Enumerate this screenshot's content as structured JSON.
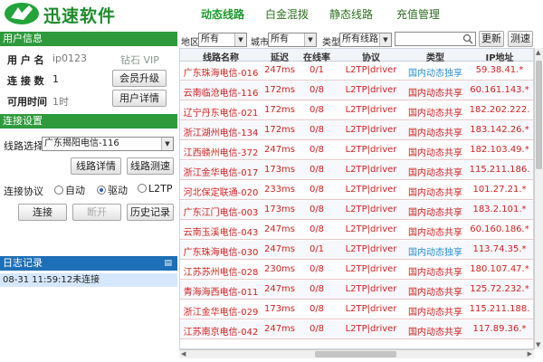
{
  "app": {
    "brand": "迅速软件",
    "nav_tabs": [
      "动态线路",
      "白金混拨",
      "静态线路",
      "充值管理"
    ]
  },
  "user_info": {
    "header": "用户信息",
    "username_label": "用 户 名",
    "username": "ip0123",
    "level": "钻石 VIP",
    "connections_label": "连 接 数",
    "connections": "1",
    "available_label": "可用时间",
    "available_time": "1时",
    "upgrade_button": "会员升级",
    "details_button": "用户详情"
  },
  "connection": {
    "header": "连接设置",
    "line_select_label": "线路选择",
    "line_selected": "广东揭阳电信-116",
    "line_details_button": "线路详情",
    "line_test_button": "线路测速",
    "protocol_label": "连接协议",
    "protocols": [
      "自动",
      "驱动",
      "L2TP"
    ],
    "protocol_selected": "驱动",
    "connect_button": "连接",
    "disconnect_button": "断开",
    "history_button": "历史记录"
  },
  "log": {
    "header": "日志记录",
    "entries": [
      "08-31 11:59:12未连接"
    ]
  },
  "filters": {
    "region_label": "地区",
    "region_value": "所有",
    "city_label": "城市",
    "city_value": "所有",
    "type_label": "类型",
    "type_value": "所有线路",
    "refresh_button": "更新",
    "speedtest_button": "测速"
  },
  "table": {
    "columns": [
      "线路名称",
      "延迟",
      "在线率",
      "协议",
      "类型",
      "IP地址"
    ],
    "rows": [
      {
        "name": "广东珠海电信-016",
        "delay": "247ms",
        "online": "0/1",
        "protocol": "L2TP|driver",
        "type": "国内动态独享",
        "ip": "59.38.41.*",
        "kind": "b"
      },
      {
        "name": "云南临沧电信-116",
        "delay": "172ms",
        "online": "0/8",
        "protocol": "L2TP|driver",
        "type": "国内动态共享",
        "ip": "60.161.143.*",
        "kind": "a"
      },
      {
        "name": "辽宁丹东电信-021",
        "delay": "172ms",
        "online": "0/8",
        "protocol": "L2TP|driver",
        "type": "国内动态共享",
        "ip": "182.202.222.",
        "kind": "a"
      },
      {
        "name": "浙江湖州电信-134",
        "delay": "172ms",
        "online": "0/8",
        "protocol": "L2TP|driver",
        "type": "国内动态共享",
        "ip": "183.142.26.*",
        "kind": "a"
      },
      {
        "name": "江西赣州电信-372",
        "delay": "247ms",
        "online": "0/8",
        "protocol": "L2TP|driver",
        "type": "国内动态共享",
        "ip": "182.103.49.*",
        "kind": "a"
      },
      {
        "name": "浙江金华电信-017",
        "delay": "173ms",
        "online": "0/8",
        "protocol": "L2TP|driver",
        "type": "国内动态共享",
        "ip": "115.211.186.",
        "kind": "a"
      },
      {
        "name": "河北保定联通-020",
        "delay": "233ms",
        "online": "0/8",
        "protocol": "L2TP|driver",
        "type": "国内动态共享",
        "ip": "101.27.21.*",
        "kind": "a"
      },
      {
        "name": "广东江门电信-003",
        "delay": "173ms",
        "online": "0/8",
        "protocol": "L2TP|driver",
        "type": "国内动态共享",
        "ip": "183.2.101.*",
        "kind": "a"
      },
      {
        "name": "云南玉溪电信-043",
        "delay": "247ms",
        "online": "0/8",
        "protocol": "L2TP|driver",
        "type": "国内动态共享",
        "ip": "60.160.186.*",
        "kind": "a"
      },
      {
        "name": "广东珠海电信-030",
        "delay": "247ms",
        "online": "0/1",
        "protocol": "L2TP|driver",
        "type": "国内动态独享",
        "ip": "113.74.35.*",
        "kind": "b"
      },
      {
        "name": "江苏苏州电信-028",
        "delay": "230ms",
        "online": "0/8",
        "protocol": "L2TP|driver",
        "type": "国内动态共享",
        "ip": "180.107.47.*",
        "kind": "a"
      },
      {
        "name": "青海海西电信-011",
        "delay": "247ms",
        "online": "0/8",
        "protocol": "L2TP|driver",
        "type": "国内动态共享",
        "ip": "125.72.232.*",
        "kind": "a"
      },
      {
        "name": "浙江金华电信-029",
        "delay": "173ms",
        "online": "0/8",
        "protocol": "L2TP|driver",
        "type": "国内动态共享",
        "ip": "115.211.188.",
        "kind": "a"
      },
      {
        "name": "江苏南京电信-042",
        "delay": "247ms",
        "online": "0/8",
        "protocol": "L2TP|driver",
        "type": "国内动态共享",
        "ip": "117.89.36.*",
        "kind": "a"
      }
    ]
  },
  "colors": {
    "brand_green": "#1f8b2d",
    "section_green": "#2e9a3c",
    "log_blue": "#1d6fb7",
    "row_text_red": "#d42020",
    "exclusive_blue": "#2a8fd0"
  }
}
